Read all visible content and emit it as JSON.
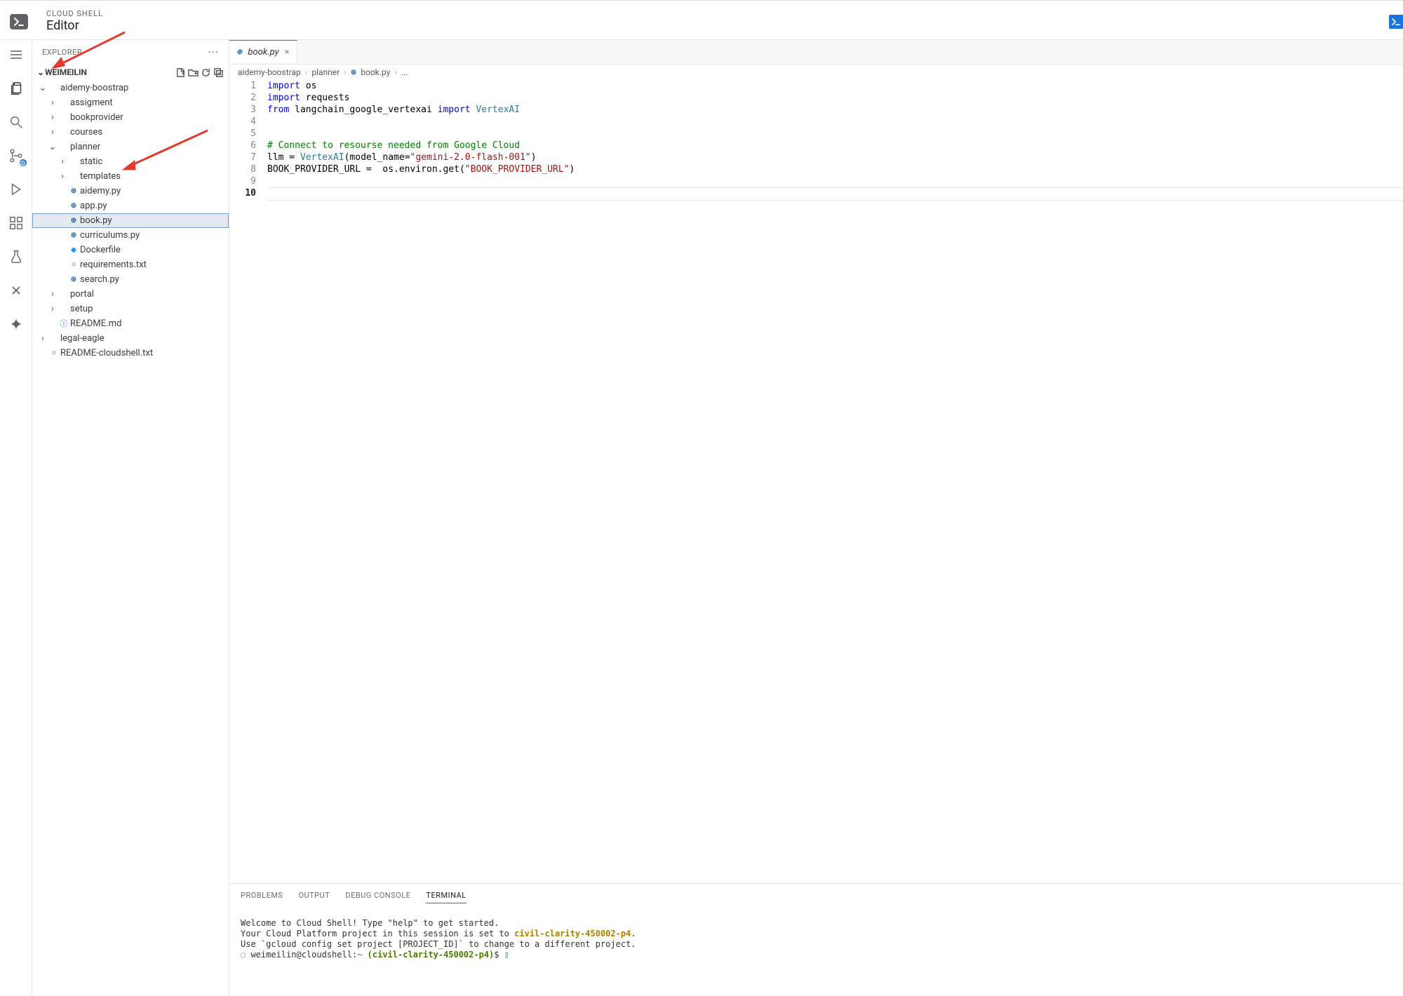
{
  "header": {
    "overline": "CLOUD SHELL",
    "title": "Editor"
  },
  "activity_bar": {
    "menu_icon": "menu-icon",
    "items": [
      {
        "name": "explorer",
        "active": true
      },
      {
        "name": "search",
        "active": false
      },
      {
        "name": "source-ctl",
        "active": false
      },
      {
        "name": "run",
        "active": false
      },
      {
        "name": "extensions",
        "active": false
      },
      {
        "name": "tests",
        "active": false
      },
      {
        "name": "cloud-code",
        "active": false
      },
      {
        "name": "gemini",
        "active": false
      }
    ]
  },
  "explorer": {
    "title": "EXPLORER",
    "root_label": "WEIMEILIN",
    "toolbar": [
      "new-file",
      "new-folder",
      "refresh",
      "collapse"
    ],
    "tree": [
      {
        "type": "folder",
        "label": "aidemy-boostrap",
        "depth": 0,
        "open": true
      },
      {
        "type": "folder",
        "label": "assigment",
        "depth": 1,
        "open": false
      },
      {
        "type": "folder",
        "label": "bookprovider",
        "depth": 1,
        "open": false
      },
      {
        "type": "folder",
        "label": "courses",
        "depth": 1,
        "open": false
      },
      {
        "type": "folder",
        "label": "planner",
        "depth": 1,
        "open": true,
        "annot": "arrow-planner"
      },
      {
        "type": "folder",
        "label": "static",
        "depth": 2,
        "open": false
      },
      {
        "type": "folder",
        "label": "templates",
        "depth": 2,
        "open": false
      },
      {
        "type": "file",
        "label": "aidemy.py",
        "depth": 2,
        "icon": "py"
      },
      {
        "type": "file",
        "label": "app.py",
        "depth": 2,
        "icon": "py"
      },
      {
        "type": "file",
        "label": "book.py",
        "depth": 2,
        "icon": "py",
        "selected": true
      },
      {
        "type": "file",
        "label": "curriculums.py",
        "depth": 2,
        "icon": "py"
      },
      {
        "type": "file",
        "label": "Dockerfile",
        "depth": 2,
        "icon": "docker"
      },
      {
        "type": "file",
        "label": "requirements.txt",
        "depth": 2,
        "icon": "txt"
      },
      {
        "type": "file",
        "label": "search.py",
        "depth": 2,
        "icon": "py"
      },
      {
        "type": "folder",
        "label": "portal",
        "depth": 1,
        "open": false
      },
      {
        "type": "folder",
        "label": "setup",
        "depth": 1,
        "open": false
      },
      {
        "type": "file",
        "label": "README.md",
        "depth": 1,
        "icon": "info"
      },
      {
        "type": "folder",
        "label": "legal-eagle",
        "depth": 0,
        "open": false
      },
      {
        "type": "file",
        "label": "README-cloudshell.txt",
        "depth": 0,
        "icon": "txt"
      }
    ]
  },
  "tab": {
    "filename": "book.py"
  },
  "breadcrumb": [
    "aidemy-boostrap",
    "planner",
    "book.py",
    "..."
  ],
  "code_lines": [
    [
      {
        "t": "import ",
        "c": "kw"
      },
      {
        "t": "os",
        "c": "id"
      }
    ],
    [
      {
        "t": "import ",
        "c": "kw"
      },
      {
        "t": "requests",
        "c": "id"
      }
    ],
    [
      {
        "t": "from ",
        "c": "kw"
      },
      {
        "t": "langchain_google_vertexai ",
        "c": "id"
      },
      {
        "t": "import ",
        "c": "kw"
      },
      {
        "t": "VertexAI",
        "c": "cls"
      }
    ],
    [],
    [],
    [
      {
        "t": "# Connect to resourse needed from Google Cloud",
        "c": "com"
      }
    ],
    [
      {
        "t": "llm ",
        "c": "id"
      },
      {
        "t": "= ",
        "c": "punc"
      },
      {
        "t": "VertexAI",
        "c": "cls"
      },
      {
        "t": "(",
        "c": "punc"
      },
      {
        "t": "model_name",
        "c": "id"
      },
      {
        "t": "=",
        "c": "punc"
      },
      {
        "t": "\"gemini-2.0-flash-001\"",
        "c": "str"
      },
      {
        "t": ")",
        "c": "punc"
      }
    ],
    [
      {
        "t": "BOOK_PROVIDER_URL ",
        "c": "id"
      },
      {
        "t": "=  ",
        "c": "punc"
      },
      {
        "t": "os",
        "c": "id"
      },
      {
        "t": ".",
        "c": "punc"
      },
      {
        "t": "environ",
        "c": "id"
      },
      {
        "t": ".",
        "c": "punc"
      },
      {
        "t": "get",
        "c": "id"
      },
      {
        "t": "(",
        "c": "punc"
      },
      {
        "t": "\"BOOK_PROVIDER_URL\"",
        "c": "str"
      },
      {
        "t": ")",
        "c": "punc"
      }
    ],
    [],
    []
  ],
  "current_line": 10,
  "panel_tabs": {
    "items": [
      "PROBLEMS",
      "OUTPUT",
      "DEBUG CONSOLE",
      "TERMINAL"
    ],
    "active": "TERMINAL"
  },
  "terminal": {
    "line1": "Welcome to Cloud Shell! Type \"help\" to get started.",
    "line2_pre": "Your Cloud Platform project in this session is set to ",
    "line2_project": "civil-clarity-450002-p4",
    "line2_post": ".",
    "line3": "Use `gcloud config set project [PROJECT_ID]` to change to a different project.",
    "prompt_user": "weimeilin@cloudshell",
    "prompt_sep": ":",
    "prompt_path": "~",
    "prompt_project": "(civil-clarity-450002-p4)",
    "prompt_sym": "$"
  }
}
